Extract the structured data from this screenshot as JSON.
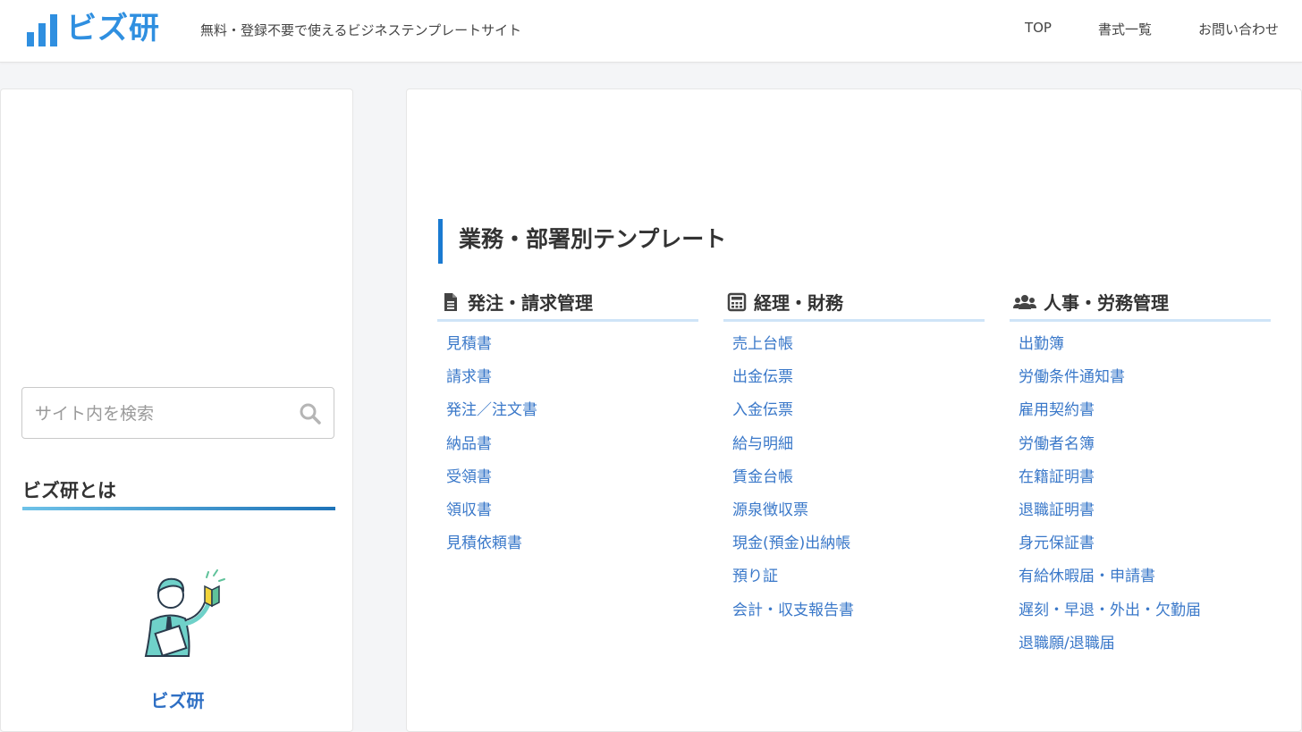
{
  "header": {
    "logo_text": "ビズ研",
    "tagline": "無料・登録不要で使えるビジネステンプレートサイト",
    "nav": [
      "TOP",
      "書式一覧",
      "お問い合わせ"
    ]
  },
  "sidebar": {
    "search_placeholder": "サイト内を検索",
    "about_title": "ビズ研とは",
    "about_name": "ビズ研"
  },
  "main": {
    "section_title": "業務・部署別テンプレート",
    "columns": [
      {
        "heading": "発注・請求管理",
        "icon": "document-icon",
        "items": [
          "見積書",
          "請求書",
          "発注／注文書",
          "納品書",
          "受領書",
          "領収書",
          "見積依頼書"
        ]
      },
      {
        "heading": "経理・財務",
        "icon": "calculator-icon",
        "items": [
          "売上台帳",
          "出金伝票",
          "入金伝票",
          "給与明細",
          "賃金台帳",
          "源泉徴収票",
          "現金(預金)出納帳",
          "預り証",
          "会計・収支報告書"
        ]
      },
      {
        "heading": "人事・労務管理",
        "icon": "users-icon",
        "items": [
          "出勤簿",
          "労働条件通知書",
          "雇用契約書",
          "労働者名簿",
          "在籍証明書",
          "退職証明書",
          "身元保証書",
          "有給休暇届・申請書",
          "遅刻・早退・外出・欠勤届",
          "退職願/退職届"
        ]
      }
    ]
  },
  "colors": {
    "brand": "#2f8fe0",
    "link": "#3a78c9",
    "accent": "#1a7ad1"
  }
}
